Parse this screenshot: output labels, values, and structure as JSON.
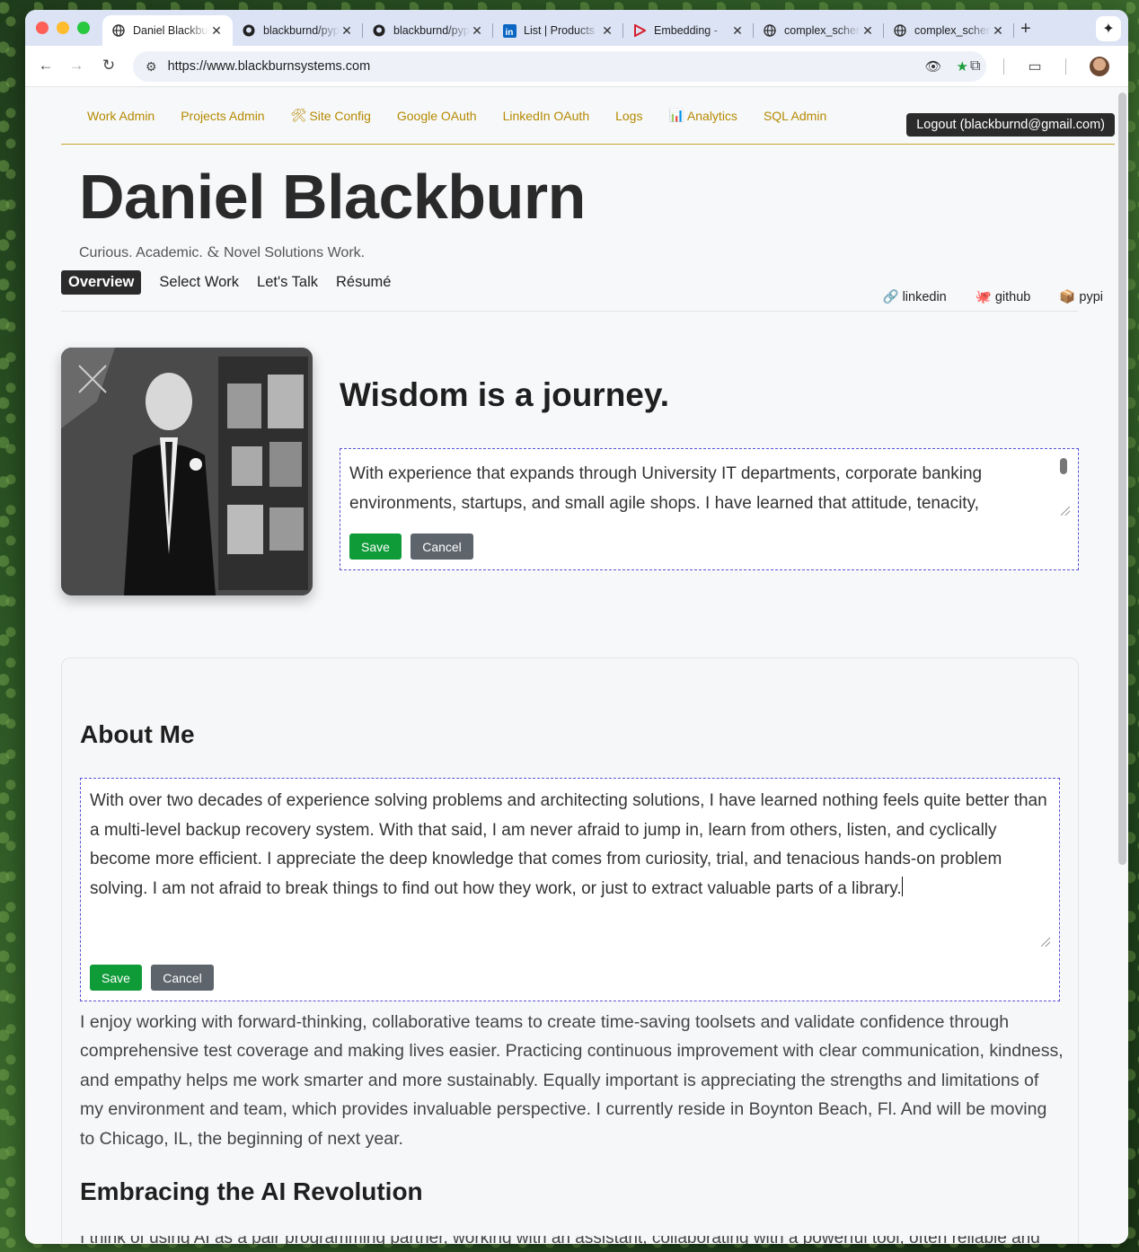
{
  "browser": {
    "tabs": [
      {
        "title": "Daniel Blackburn",
        "icon": "globe-icon"
      },
      {
        "title": "blackburnd/pypi",
        "icon": "github-icon"
      },
      {
        "title": "blackburnd/pypi",
        "icon": "github-icon"
      },
      {
        "title": "List | Products",
        "icon": "linkedin-icon"
      },
      {
        "title": "Embedding -",
        "icon": "play-icon"
      },
      {
        "title": "complex_schema",
        "icon": "globe-icon"
      },
      {
        "title": "complex_schema",
        "icon": "globe-icon"
      }
    ],
    "url": "https://www.blackburnsystems.com"
  },
  "admin_bar": {
    "links": [
      "Work Admin",
      "Projects Admin",
      "Site Config",
      "Google OAuth",
      "LinkedIn OAuth",
      "Logs",
      "Analytics",
      "SQL Admin"
    ],
    "logout": "Logout (blackburnd@gmail.com)"
  },
  "header": {
    "title": "Daniel Blackburn",
    "tagline_a": "Curious. Academic.",
    "tagline_amp": "&",
    "tagline_b": "Novel Solutions Work."
  },
  "nav": {
    "items": [
      "Overview",
      "Select Work",
      "Let's Talk",
      "Résumé"
    ],
    "social": [
      "linkedin",
      "github",
      "pypi"
    ]
  },
  "hero": {
    "title": "Wisdom is a journey.",
    "text": "With experience that expands through University IT departments, corporate banking environments, startups, and small agile shops. I have learned that attitude, tenacity,",
    "save": "Save",
    "cancel": "Cancel"
  },
  "about": {
    "heading": "About Me",
    "edit_text": "With over two decades of experience solving problems and architecting solutions, I have learned nothing feels quite better than a multi-level backup recovery system.  With that said, I am never afraid to jump in, learn from others, listen, and cyclically become more efficient. I appreciate the deep knowledge that comes from curiosity, trial, and tenacious hands-on problem solving.  I am not afraid to break things to find out how they work, or just to extract valuable parts of a library.",
    "save": "Save",
    "cancel": "Cancel",
    "paragraph": "I enjoy working with forward-thinking, collaborative teams to create time-saving toolsets and validate confidence through comprehensive test coverage and making lives easier. Practicing continuous improvement with clear communication, kindness, and empathy helps me work smarter and more sustainably. Equally important is appreciating the strengths and limitations of my environment and team, which provides invaluable perspective. I currently reside in Boynton Beach, Fl. And will be moving to Chicago, IL, the beginning of next year.",
    "ai_heading": "Embracing the AI Revolution",
    "ai_text_partial": "I think of using AI as a pair programming partner, working with an assistant, collaborating with a powerful tool, often reliable and with"
  }
}
